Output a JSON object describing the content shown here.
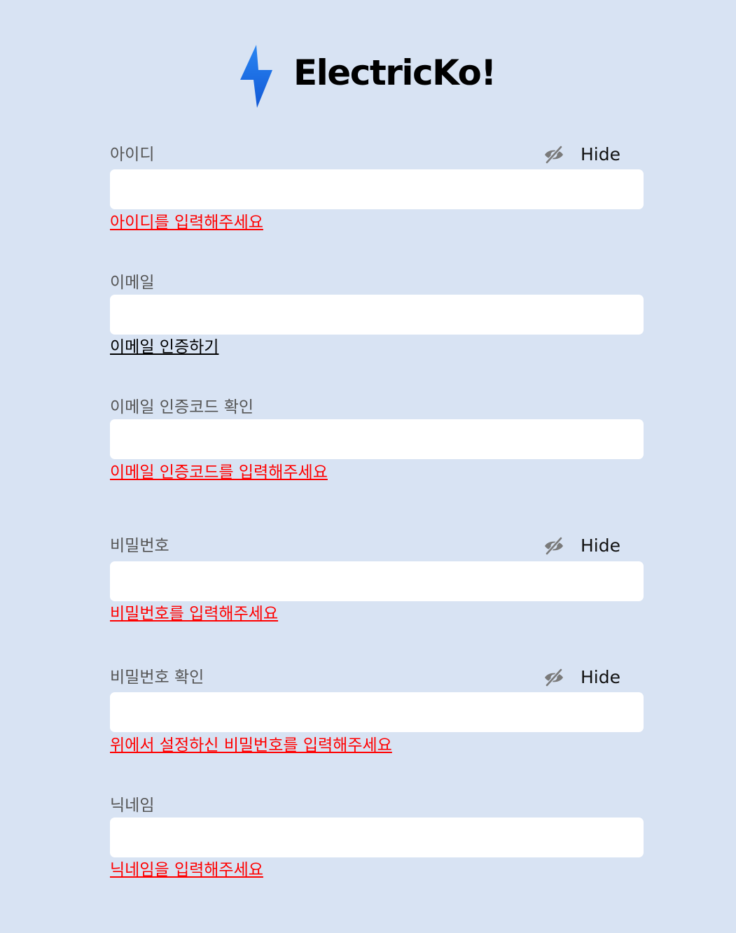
{
  "header": {
    "brand": "ElectricKo!",
    "logo_icon": "lightning-bolt-icon",
    "logo_color": "#1b6fe6"
  },
  "colors": {
    "background": "#d8e3f3",
    "error": "#ff0000",
    "input_bg": "#ffffff"
  },
  "form": {
    "id": {
      "label": "아이디",
      "toggle_label": "Hide",
      "toggle_icon": "eye-off-icon",
      "value": "",
      "error": "아이디를 입력해주세요"
    },
    "email": {
      "label": "이메일",
      "value": "",
      "link": "이메일 인증하기"
    },
    "email_code": {
      "label": "이메일 인증코드 확인",
      "value": "",
      "error": "이메일 인증코드를 입력해주세요"
    },
    "password": {
      "label": "비밀번호",
      "toggle_label": "Hide",
      "toggle_icon": "eye-off-icon",
      "value": "",
      "error": "비밀번호를 입력해주세요"
    },
    "password_confirm": {
      "label": "비밀번호 확인",
      "toggle_label": "Hide",
      "toggle_icon": "eye-off-icon",
      "value": "",
      "error": "위에서 설정하신 비밀번호를 입력해주세요"
    },
    "nickname": {
      "label": "닉네임",
      "value": "",
      "error": "닉네임을 입력해주세요"
    }
  }
}
